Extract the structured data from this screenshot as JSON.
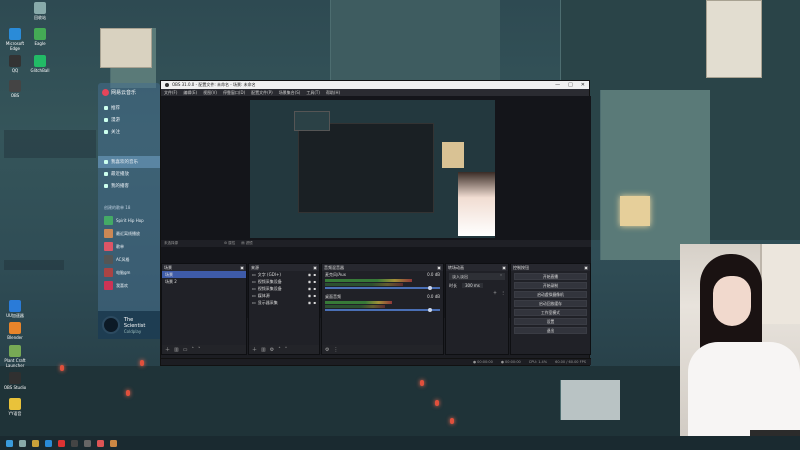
{
  "desktop": {
    "icons": [
      {
        "label": "回收站",
        "color": "#8aa"
      },
      {
        "label": "Microsoft Edge",
        "color": "#2a8bd8"
      },
      {
        "label": "Eagle",
        "color": "#4a5"
      },
      {
        "label": "QQ",
        "color": "#333"
      },
      {
        "label": "GlitchBall",
        "color": "#2b6"
      },
      {
        "label": "OBS",
        "color": "#444"
      },
      {
        "label": "UU加速器",
        "color": "#2a7bd8"
      },
      {
        "label": "Blender",
        "color": "#e8842a"
      },
      {
        "label": "Plant Craft Launcher",
        "color": "#7a5"
      },
      {
        "label": "OBS Studio",
        "color": "#303030"
      },
      {
        "label": "YY语音",
        "color": "#e9c23a"
      }
    ]
  },
  "music_app": {
    "title": "网易云音乐",
    "menu": [
      "推荐",
      "漫游",
      "关注"
    ],
    "selected": "我喜欢的音乐",
    "menu2": [
      "我喜欢的音乐",
      "最近播放",
      "我的播客"
    ],
    "playlist_header": "创建的歌单 18",
    "playlists": [
      {
        "name": "Spirit Hip Hop",
        "color": "#4a6"
      },
      {
        "name": "最近离线播放",
        "color": "#c85"
      },
      {
        "name": "歌单",
        "color": "#d56"
      },
      {
        "name": "AC风格",
        "color": "#555"
      },
      {
        "name": "电脑gm",
        "color": "#a44"
      },
      {
        "name": "我喜欢",
        "color": "#c35"
      }
    ],
    "now_playing": {
      "title": "The Scientist",
      "artist": "Coldplay"
    }
  },
  "obs": {
    "title": "OBS 31.0.0 - 配置文件: 未命名 - 场景: 未命名",
    "window_controls": [
      "—",
      "□",
      "✕"
    ],
    "menu": [
      "文件(F)",
      "编辑(E)",
      "视图(V)",
      "停靠窗口(D)",
      "配置文件(P)",
      "场景集合(S)",
      "工具(T)",
      "帮助(H)"
    ],
    "source_toolbar": [
      "未选择源",
      "属性",
      "滤镜"
    ],
    "scenes_dock": {
      "title": "场景",
      "items": [
        "场景",
        "场景 2"
      ]
    },
    "sources_dock": {
      "title": "来源",
      "items": [
        "文字 (GDI+)",
        "视频采集设备",
        "视频采集设备",
        "媒体源",
        "显示器采集"
      ]
    },
    "mixer_dock": {
      "title": "音频混音器",
      "channels": [
        {
          "name": "麦克风/Aux",
          "db": "0.0 dB",
          "level": 0.72
        },
        {
          "name": "桌面音频",
          "db": "0.0 dB",
          "level": 0.55
        }
      ]
    },
    "transitions_dock": {
      "title": "转场动画",
      "type": "淡入淡出",
      "duration_label": "时长",
      "duration": "300 ms"
    },
    "controls_dock": {
      "title": "控制按钮",
      "buttons": [
        "开始直播",
        "开始录制",
        "启动虚拟摄像机",
        "启动回放缓存",
        "工作室模式",
        "设置",
        "退出"
      ]
    },
    "status": {
      "stream_time": "00:00:00",
      "rec_time": "00:00:00",
      "cpu": "CPU: 1.4%",
      "fps": "60.00 / 60.00 FPS"
    }
  }
}
